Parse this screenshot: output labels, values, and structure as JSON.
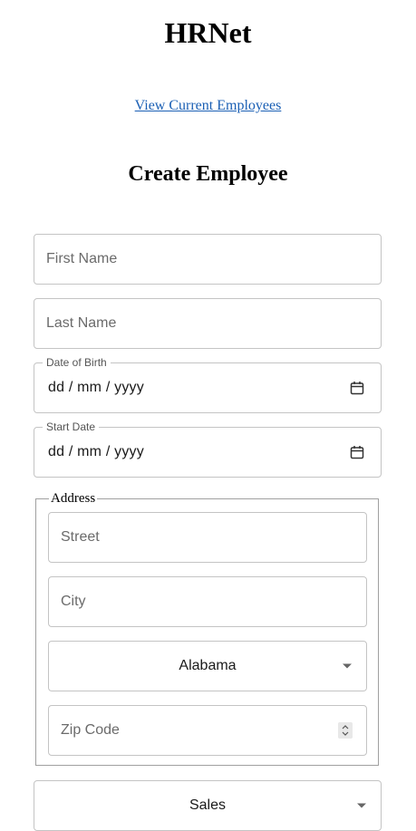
{
  "app": {
    "title": "HRNet"
  },
  "nav": {
    "view_employees_link": "View Current Employees"
  },
  "form": {
    "heading": "Create Employee",
    "first_name": {
      "placeholder": "First Name"
    },
    "last_name": {
      "placeholder": "Last Name"
    },
    "date_of_birth": {
      "label": "Date of Birth",
      "value": "dd / mm / yyyy",
      "icon": "calendar-icon"
    },
    "start_date": {
      "label": "Start Date",
      "value": "dd / mm / yyyy",
      "icon": "calendar-icon"
    },
    "address": {
      "legend": "Address",
      "street": {
        "placeholder": "Street"
      },
      "city": {
        "placeholder": "City"
      },
      "state": {
        "selected": "Alabama",
        "icon": "chevron-down-icon"
      },
      "zip": {
        "placeholder": "Zip Code",
        "icon": "number-stepper-icon"
      }
    },
    "department": {
      "selected": "Sales",
      "icon": "chevron-down-icon"
    }
  }
}
